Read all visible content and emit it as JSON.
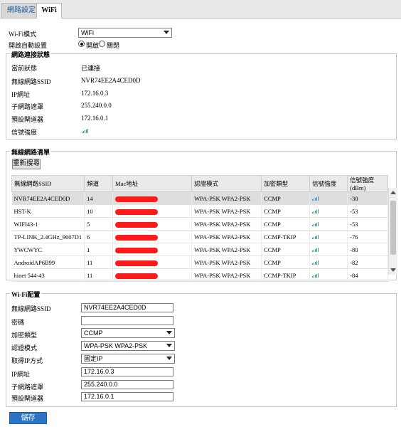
{
  "tabs": [
    {
      "label": "網路設定"
    },
    {
      "label": "WiFi"
    }
  ],
  "wifi_mode": {
    "label": "Wi-Fi模式",
    "value": "WiFi"
  },
  "auto_scan": {
    "label": "開啟自動設置",
    "on_label": "開啟",
    "off_label": "關閉",
    "selected": "開啟"
  },
  "status": {
    "legend": "網路連接狀態",
    "rows": [
      {
        "label": "當前狀態",
        "value": "已連接"
      },
      {
        "label": "無線網路SSID",
        "value": "NVR74EE2A4CED0D"
      },
      {
        "label": "IP網址",
        "value": "172.16.0.3"
      },
      {
        "label": "子網路遮罩",
        "value": "255.240.0.0"
      },
      {
        "label": "預設閘道器",
        "value": "172.16.0.1"
      },
      {
        "label": "信號強度",
        "value": ""
      }
    ],
    "signal_icon": "wifi-signal-bars"
  },
  "network_list": {
    "legend": "無線網路清單",
    "refresh_label": "重新搜尋",
    "columns": [
      "無線網路SSID",
      "頻道",
      "Mac地址",
      "認證模式",
      "加密類型",
      "信號強度",
      "信號強度(dBm)"
    ],
    "rows": [
      {
        "ssid": "NVR74EE2A4CED0D",
        "channel": "14",
        "auth": "WPA-PSK WPA2-PSK",
        "enc": "CCMP",
        "dbm": "-30"
      },
      {
        "ssid": "HST-K",
        "channel": "10",
        "auth": "WPA-PSK WPA2-PSK",
        "enc": "CCMP",
        "dbm": "-53"
      },
      {
        "ssid": "WIFI43-1",
        "channel": "5",
        "auth": "WPA-PSK WPA2-PSK",
        "enc": "CCMP",
        "dbm": "-53"
      },
      {
        "ssid": "TP-LINK_2.4GHz_9607D1",
        "channel": "6",
        "auth": "WPA-PSK WPA2-PSK",
        "enc": "CCMP-TKIP",
        "dbm": "-76"
      },
      {
        "ssid": "YWCWYC",
        "channel": "1",
        "auth": "WPA-PSK WPA2-PSK",
        "enc": "CCMP",
        "dbm": "-80"
      },
      {
        "ssid": "AndroidAP6B99",
        "channel": "11",
        "auth": "WPA-PSK WPA2-PSK",
        "enc": "CCMP",
        "dbm": "-82"
      },
      {
        "ssid": "hinet 544-43",
        "channel": "11",
        "auth": "WPA-PSK WPA2-PSK",
        "enc": "CCMP-TKIP",
        "dbm": "-84"
      }
    ],
    "mac_redaction_color": "#ff1a1a"
  },
  "config": {
    "legend": "Wi-Fi配置",
    "ssid_label": "無線網路SSID",
    "ssid_value": "NVR74EE2A4CED0D",
    "password_label": "密碼",
    "password_value": "",
    "enc_label": "加密類型",
    "enc_value": "CCMP",
    "auth_label": "認證模式",
    "auth_value": "WPA-PSK WPA2-PSK",
    "ipmode_label": "取得IP方式",
    "ipmode_value": "固定IP",
    "ip_label": "IP網址",
    "ip_value": "172.16.0.3",
    "mask_label": "子網路遮罩",
    "mask_value": "255.240.0.0",
    "gateway_label": "預設閘道器",
    "gateway_value": "172.16.0.1"
  },
  "save_label": "儲存",
  "accent_color": "#2a73c6"
}
